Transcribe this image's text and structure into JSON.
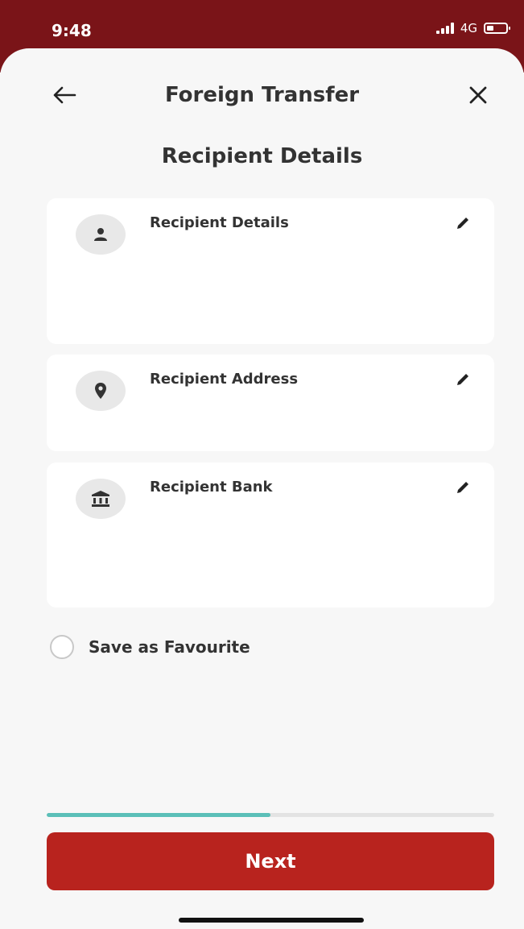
{
  "status_bar": {
    "time": "9:48",
    "network": "4G",
    "battery_level": 0.45
  },
  "header": {
    "title": "Foreign Transfer",
    "back_icon": "arrow-left-icon",
    "close_icon": "close-icon"
  },
  "page": {
    "title": "Recipient Details"
  },
  "cards": [
    {
      "label": "Recipient Details",
      "icon": "person-icon"
    },
    {
      "label": "Recipient Address",
      "icon": "location-pin-icon"
    },
    {
      "label": "Recipient Bank",
      "icon": "bank-icon"
    }
  ],
  "favourite": {
    "label": "Save as Favourite",
    "checked": false
  },
  "progress": {
    "value": 0.5
  },
  "actions": {
    "next_label": "Next"
  },
  "colors": {
    "header_bg": "#7a1418",
    "primary": "#b8231e",
    "progress": "#5bbfb8"
  }
}
